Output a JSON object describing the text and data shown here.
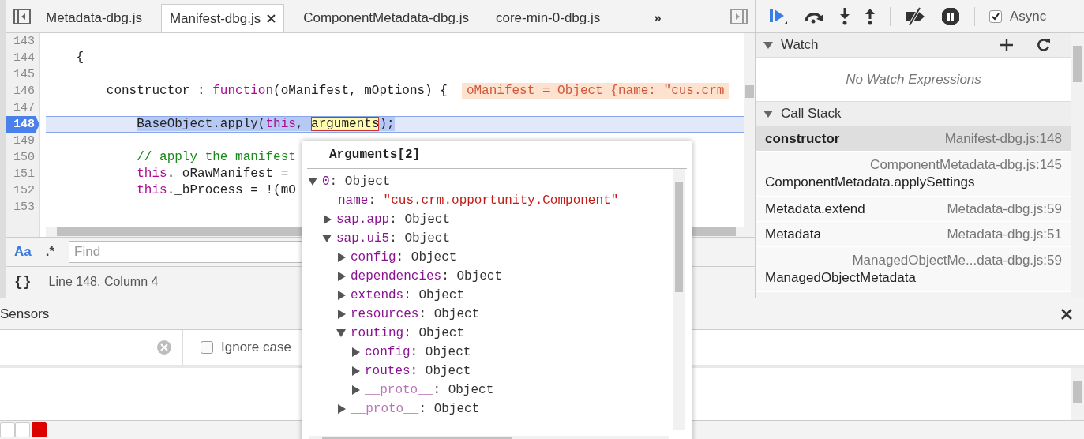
{
  "editor": {
    "tabs": [
      {
        "label": "Metadata-dbg.js",
        "selected": false,
        "closable": false
      },
      {
        "label": "Manifest-dbg.js",
        "selected": true,
        "closable": true
      },
      {
        "label": "ComponentMetadata-dbg.js",
        "selected": false,
        "closable": false
      },
      {
        "label": "core-min-0-dbg.js",
        "selected": false,
        "closable": false
      }
    ],
    "more": "»",
    "lines": [
      {
        "number": "143",
        "current": false
      },
      {
        "number": "144",
        "current": false,
        "segments": [
          {
            "kind": "plain",
            "text": "    {"
          }
        ]
      },
      {
        "number": "145",
        "current": false
      },
      {
        "number": "146",
        "current": false,
        "segments": [
          {
            "kind": "plain",
            "text": "        constructor : "
          },
          {
            "kind": "keyword",
            "text": "function"
          },
          {
            "kind": "plain",
            "text": "(oManifest, mOptions) {"
          }
        ],
        "inline_value": "oManifest = Object {name: \"cus.crm"
      },
      {
        "number": "147",
        "current": false
      },
      {
        "number": "148",
        "current": true,
        "segments": [
          {
            "kind": "selected",
            "text": "            BaseObject.apply("
          },
          {
            "kind": "selected-keyword",
            "text": "this"
          },
          {
            "kind": "selected",
            "text": ", "
          },
          {
            "kind": "hovered",
            "text": "arguments"
          },
          {
            "kind": "selected",
            "text": ");"
          }
        ]
      },
      {
        "number": "149",
        "current": false
      },
      {
        "number": "150",
        "current": false,
        "segments": [
          {
            "kind": "comment",
            "text": "            // apply the manifest"
          }
        ]
      },
      {
        "number": "151",
        "current": false,
        "segments": [
          {
            "kind": "keyword",
            "text": "            this"
          },
          {
            "kind": "plain",
            "text": "._oRawManifest ="
          }
        ]
      },
      {
        "number": "152",
        "current": false,
        "segments": [
          {
            "kind": "keyword",
            "text": "            this"
          },
          {
            "kind": "plain",
            "text": "._bProcess = !(mO"
          }
        ]
      },
      {
        "number": "153",
        "current": false
      }
    ],
    "find": {
      "case_label": "Aa",
      "regex_label": ".*",
      "placeholder": "Find"
    },
    "status": {
      "format_icon": "{}",
      "position": "Line 148, Column 4"
    }
  },
  "debugger": {
    "async": {
      "label": "Async",
      "checked": true
    },
    "watch": {
      "title": "Watch",
      "expanded": true,
      "empty_text": "No Watch Expressions"
    },
    "call_stack": {
      "title": "Call Stack",
      "expanded": true,
      "frames": [
        {
          "name": "constructor",
          "location": "Manifest-dbg.js:148",
          "selected": true,
          "kind": "inline"
        },
        {
          "name": "ComponentMetadata.applySettings",
          "location": "ComponentMetadata-dbg.js:145",
          "selected": false,
          "kind": "wrapped"
        },
        {
          "name": "Metadata.extend",
          "location": "Metadata-dbg.js:59",
          "selected": false,
          "kind": "inline"
        },
        {
          "name": "Metadata",
          "location": "Metadata-dbg.js:51",
          "selected": false,
          "kind": "inline"
        },
        {
          "name": "ManagedObjectMetadata",
          "location": "ManagedObjectMe...data-dbg.js:59",
          "selected": false,
          "kind": "wrapped"
        }
      ]
    }
  },
  "popover": {
    "title": "Arguments[2]",
    "separator": ":",
    "tree": [
      {
        "key": "0",
        "value": "Object",
        "kind": "object",
        "internal": false,
        "expanded": true,
        "children": [
          {
            "key": "name",
            "value": "\"cus.crm.opportunity.Component\"",
            "kind": "string",
            "internal": false
          },
          {
            "key": "sap.app",
            "value": "Object",
            "kind": "object",
            "internal": false,
            "expanded": false
          },
          {
            "key": "sap.ui5",
            "value": "Object",
            "kind": "object",
            "internal": false,
            "expanded": true,
            "children": [
              {
                "key": "config",
                "value": "Object",
                "kind": "object",
                "internal": false,
                "expanded": false
              },
              {
                "key": "dependencies",
                "value": "Object",
                "kind": "object",
                "internal": false,
                "expanded": false
              },
              {
                "key": "extends",
                "value": "Object",
                "kind": "object",
                "internal": false,
                "expanded": false
              },
              {
                "key": "resources",
                "value": "Object",
                "kind": "object",
                "internal": false,
                "expanded": false
              },
              {
                "key": "routing",
                "value": "Object",
                "kind": "object",
                "internal": false,
                "expanded": true,
                "children": [
                  {
                    "key": "config",
                    "value": "Object",
                    "kind": "object",
                    "internal": false,
                    "expanded": false
                  },
                  {
                    "key": "routes",
                    "value": "Object",
                    "kind": "object",
                    "internal": false,
                    "expanded": false
                  },
                  {
                    "key": "__proto__",
                    "value": "Object",
                    "kind": "object",
                    "internal": true,
                    "expanded": false
                  }
                ]
              },
              {
                "key": "__proto__",
                "value": "Object",
                "kind": "object",
                "internal": true,
                "expanded": false
              }
            ]
          }
        ]
      }
    ]
  },
  "drawer": {
    "tab": "Sensors",
    "ignore_case": {
      "label": "Ignore case",
      "checked": false
    }
  }
}
